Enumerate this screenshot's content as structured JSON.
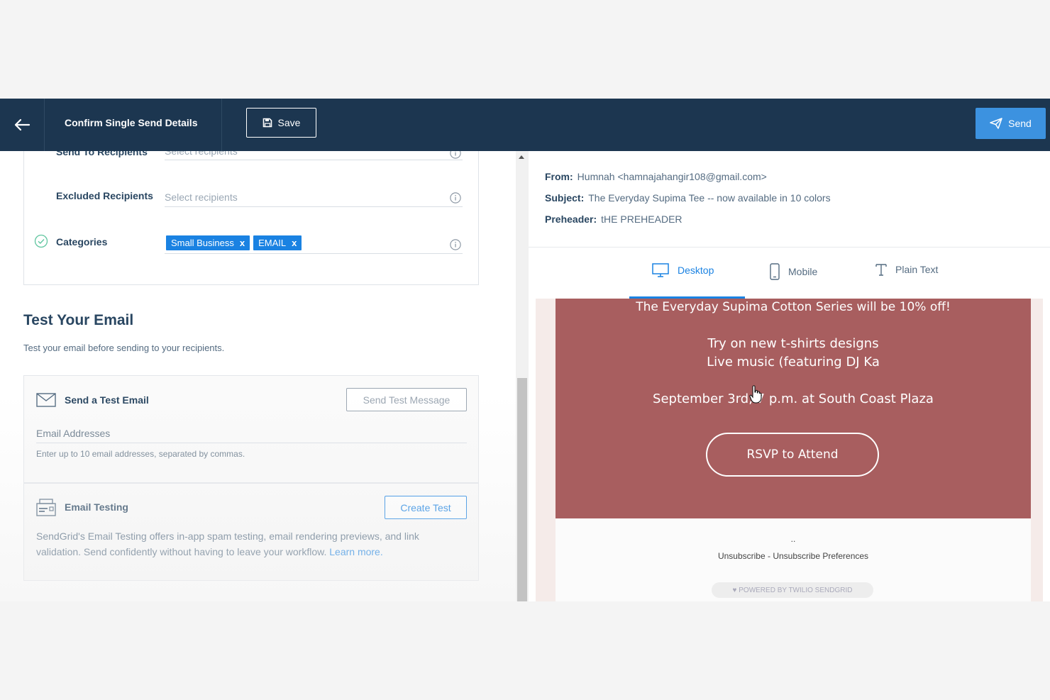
{
  "header": {
    "title": "Confirm Single Send Details",
    "save_label": "Save",
    "send_label": "Send"
  },
  "recipients": {
    "send_to_label": "Send To Recipients",
    "send_to_placeholder": "Select recipients",
    "excluded_label": "Excluded Recipients",
    "excluded_placeholder": "Select recipients",
    "categories_label": "Categories",
    "categories": [
      "Small Business",
      "EMAIL"
    ],
    "chip_remove": "x"
  },
  "test_section": {
    "title": "Test Your Email",
    "description": "Test your email before sending to your recipients."
  },
  "test_email": {
    "title": "Send a Test Email",
    "button": "Send Test Message",
    "field_label": "Email Addresses",
    "helper": "Enter up to 10 email addresses, separated by commas."
  },
  "email_testing": {
    "title": "Email Testing",
    "button": "Create Test",
    "description": "SendGrid's Email Testing offers in-app spam testing, email rendering previews, and link validation. Send confidently without having to leave your workflow.",
    "link": "Learn more."
  },
  "meta": {
    "from_label": "From:",
    "from_value": "Humnah <hamnajahangir108@gmail.com>",
    "subject_label": "Subject:",
    "subject_value": "The Everyday Supima Tee -- now available in 10 colors",
    "preheader_label": "Preheader:",
    "preheader_value": "tHE PREHEADER"
  },
  "tabs": {
    "desktop": "Desktop",
    "mobile": "Mobile",
    "plain_text": "Plain Text",
    "active": "desktop"
  },
  "preview": {
    "line1": "The Everyday Supima Cotton Series will be 10% off!",
    "line2": "Try on new t-shirts designs",
    "line3": "Live music (featuring DJ Ka",
    "line4": "September 3rd, 7 p.m. at South Coast Plaza",
    "rsvp": "RSVP to Attend",
    "dots": "..",
    "unsubscribe": "Unsubscribe - Unsubscribe Preferences",
    "powered": "♥ POWERED BY TWILIO SENDGRID"
  },
  "colors": {
    "topbar": "#1c3650",
    "accent": "#1a82e2",
    "send": "#3c92e0",
    "banner": "#a85e5f"
  }
}
